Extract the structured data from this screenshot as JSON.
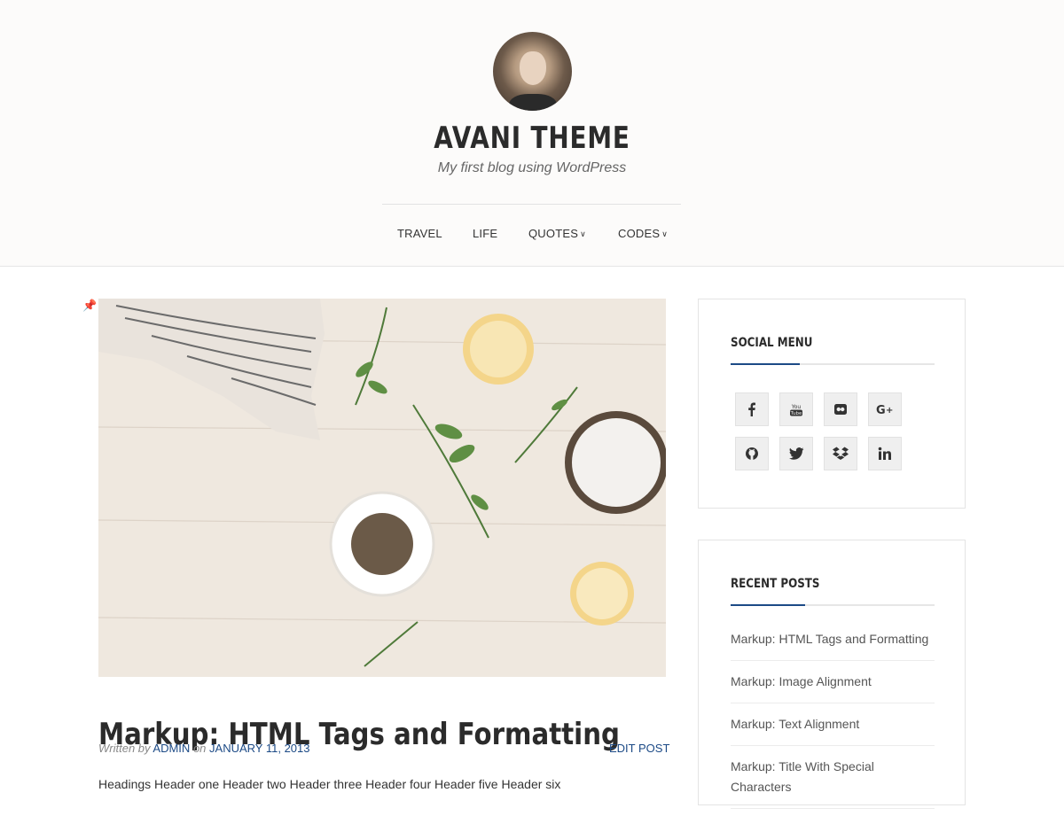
{
  "site": {
    "title": "AVANI THEME",
    "tagline": "My first blog using WordPress"
  },
  "nav": {
    "items": [
      {
        "label": "TRAVEL",
        "has_dropdown": false
      },
      {
        "label": "LIFE",
        "has_dropdown": false
      },
      {
        "label": "QUOTES",
        "has_dropdown": true
      },
      {
        "label": "CODES",
        "has_dropdown": true
      }
    ]
  },
  "post": {
    "title": "Markup: HTML Tags and Formatting",
    "written_by_label": "Written by",
    "author": "ADMIN",
    "on_label": "on",
    "date": "JANUARY 11, 2013",
    "edit_label": "EDIT POST",
    "excerpt": "Headings Header one Header two Header three Header four Header five Header six",
    "sticky_icon": "pin-icon",
    "image_icon": "featured-image"
  },
  "sidebar": {
    "social": {
      "title": "SOCIAL MENU",
      "icons": [
        "facebook-icon",
        "youtube-icon",
        "flickr-icon",
        "google-plus-icon",
        "github-icon",
        "twitter-icon",
        "dropbox-icon",
        "linkedin-icon"
      ]
    },
    "recent": {
      "title": "RECENT POSTS",
      "posts": [
        "Markup: HTML Tags and Formatting",
        "Markup: Image Alignment",
        "Markup: Text Alignment",
        "Markup: Title With Special Characters"
      ]
    }
  },
  "colors": {
    "accent": "#1c4a86",
    "text": "#2b2b2b",
    "header_bg": "#fcfbfa"
  }
}
